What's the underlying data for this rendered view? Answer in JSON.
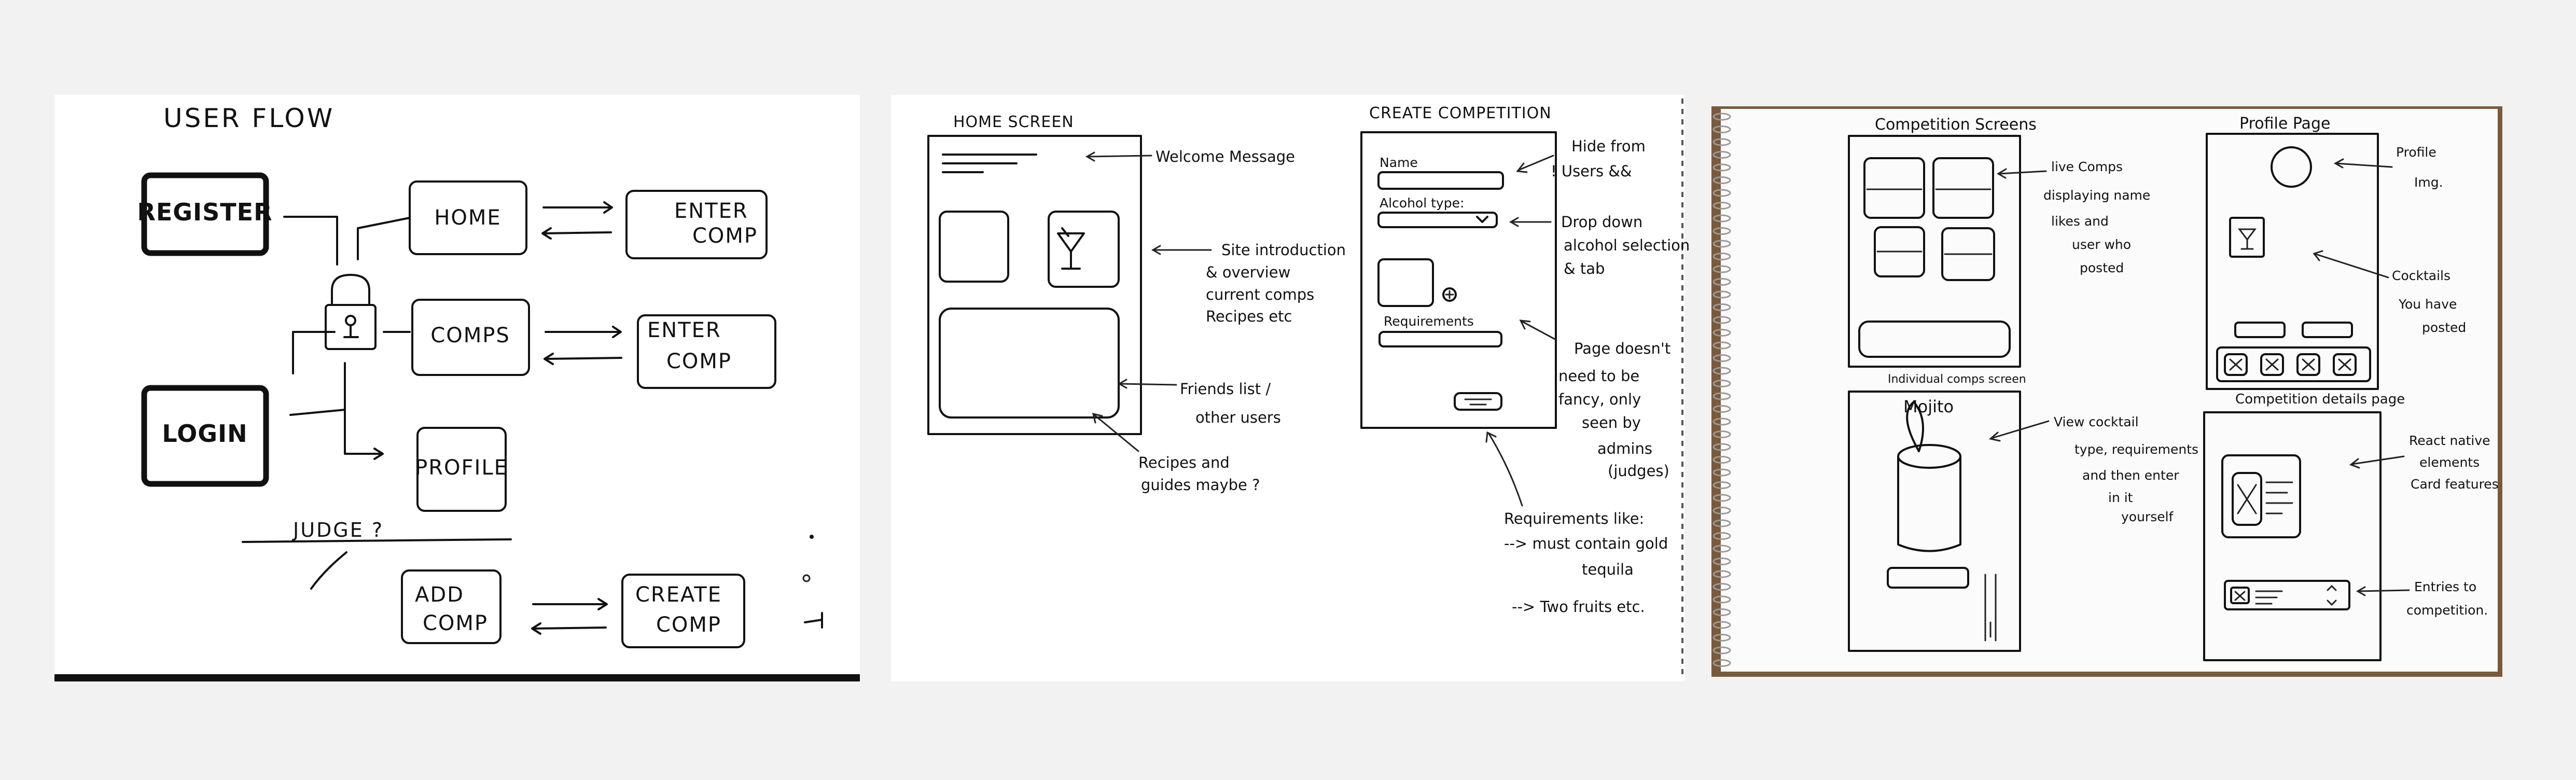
{
  "colors": {
    "background": "#f2f2f2",
    "paper": "#ffffff",
    "ink": "#111111",
    "spiral": "#9a9a9a",
    "notebook_edge": "#7a5a3a"
  },
  "user_flow": {
    "title": "USER FLOW",
    "register": "REGISTER",
    "login": "LOGIN",
    "home": "HOME",
    "comps": "COMPS",
    "profile": "PROFILE",
    "enter_comp_1a": "ENTER",
    "enter_comp_1b": "COMP",
    "enter_comp_2a": "ENTER",
    "enter_comp_2b": "COMP",
    "judge": "JUDGE ?",
    "add_comp_a": "ADD",
    "add_comp_b": "COMP",
    "create_comp_a": "CREATE",
    "create_comp_b": "COMP",
    "icons": [
      "lock-icon"
    ]
  },
  "screens": {
    "home_title": "HOME SCREEN",
    "home_notes": {
      "welcome": "Welcome Message",
      "site_intro": [
        "Site introduction",
        "& overview",
        "current comps",
        "Recipes etc"
      ],
      "friends": [
        "Friends list /",
        "other users"
      ],
      "recipes": [
        "Recipes and",
        "guides maybe ?"
      ]
    },
    "create_title": "CREATE COMPETITION",
    "create_form": {
      "name": "Name",
      "alcohol": "Alcohol type:",
      "requirements": "Requirements"
    },
    "create_notes": {
      "hide": [
        "Hide from",
        "! Users &&"
      ],
      "dropdown": [
        "Drop down",
        "alcohol selection",
        "& tab"
      ],
      "page_fancy": [
        "Page doesn't",
        "need to be",
        "fancy, only",
        "seen by",
        "admins",
        "(judges)"
      ],
      "req_like": [
        "Requirements like:",
        "--> must contain gold",
        "tequila",
        "--> Two fruits etc."
      ]
    }
  },
  "notebook": {
    "comp_screens_title": "Competition Screens",
    "profile_title": "Profile Page",
    "individual_title": "Individual comps screen",
    "mojito": "Mojito",
    "details_title": "Competition details page",
    "notes": {
      "live_comps": [
        "live Comps",
        "displaying name",
        "likes and",
        "user who",
        "posted"
      ],
      "profile_img": [
        "Profile",
        "Img."
      ],
      "cocktails": [
        "Cocktails",
        "You have",
        "posted"
      ],
      "view_cocktail": [
        "View cocktail",
        "type, requirements",
        "and then enter",
        "in it",
        "yourself"
      ],
      "react_native": [
        "React native",
        "elements",
        "Card features"
      ],
      "entries": [
        "Entries to",
        "competition."
      ]
    },
    "icons": [
      "cocktail-glass-icon",
      "x-icon"
    ]
  }
}
